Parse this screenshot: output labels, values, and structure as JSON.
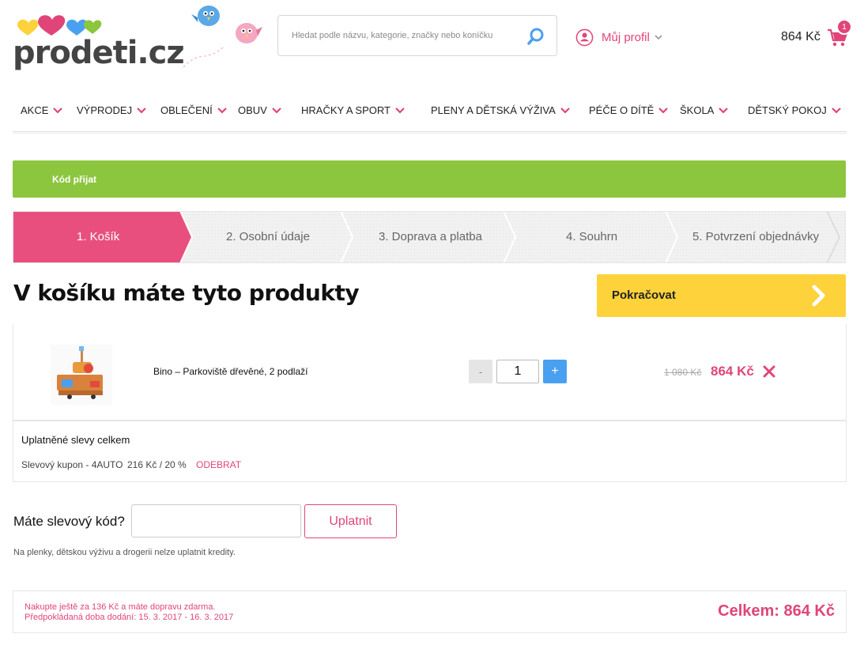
{
  "header": {
    "logo_text": "prodeti.cz",
    "search": {
      "placeholder": "Hledat podle názvu, kategorie, značky nebo koníčku",
      "value": ""
    },
    "profile_label": "Můj profil",
    "cart": {
      "price": "864 Kč",
      "count": "1"
    }
  },
  "nav": {
    "items": [
      {
        "label": "AKCE"
      },
      {
        "label": "VÝPRODEJ"
      },
      {
        "label": "OBLEČENÍ"
      },
      {
        "label": "OBUV"
      },
      {
        "label": "HRAČKY A SPORT"
      },
      {
        "label": "PLENY A DĚTSKÁ VÝŽIVA"
      },
      {
        "label": "PÉČE O DÍTĚ"
      },
      {
        "label": "ŠKOLA"
      },
      {
        "label": "DĚTSKÝ POKOJ"
      }
    ]
  },
  "alert": {
    "text": "Kód přijat"
  },
  "steps": [
    {
      "label": "1. Košík",
      "active": true
    },
    {
      "label": "2. Osobní údaje",
      "active": false
    },
    {
      "label": "3. Doprava a platba",
      "active": false
    },
    {
      "label": "4. Souhrn",
      "active": false
    },
    {
      "label": "5. Potvrzení objednávky",
      "active": false
    }
  ],
  "main": {
    "title": "V košíku máte tyto produkty",
    "continue_label": "Pokračovat"
  },
  "product": {
    "name": "Bino – Parkoviště dřevěné, 2 podlaží",
    "quantity": "1",
    "minus_label": "-",
    "plus_label": "+",
    "price_old": "1 080 Kč",
    "price_new": "864 Kč"
  },
  "discounts": {
    "title": "Uplatněné slevy celkem",
    "coupon_name": "Slevový kupon - 4AUTO",
    "coupon_amount": "216 Kč / 20 %",
    "remove_label": "ODEBRAT"
  },
  "coupon": {
    "label": "Máte slevový kód?",
    "value": "",
    "button_label": "Uplatnit",
    "note": "Na plenky, dětskou výživu a drogerii nelze uplatnit kredity."
  },
  "summary": {
    "shipping_note": "Nakupte ještě za 136 Kč a máte dopravu zdarma.",
    "delivery_note": "Předpokládaná doba dodání: 15. 3. 2017 - 16. 3. 2017",
    "total": "Celkem: 864 Kč"
  },
  "colors": {
    "brand_pink": "#e0457a",
    "success_green": "#8cc63e",
    "cta_yellow": "#fdd23a",
    "qty_blue": "#4aa0f0"
  }
}
